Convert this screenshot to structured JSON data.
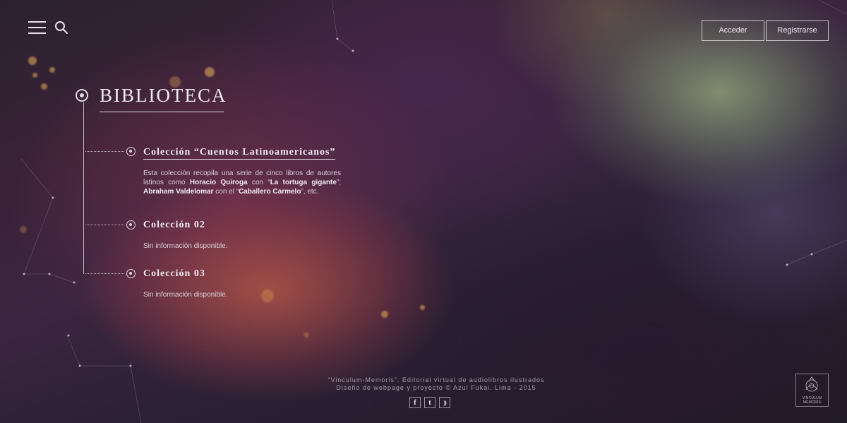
{
  "header": {
    "login_label": "Acceder",
    "register_label": "Registrarse"
  },
  "page": {
    "title": "BIBLIOTECA"
  },
  "collections": [
    {
      "title": "Colección “Cuentos Latinoamericanos”",
      "description_parts": [
        "Esta colección recopila una serie de cinco libros de autores latinos como ",
        "Horacio Quiroga",
        " con “",
        "La tortuga gigante",
        "”; ",
        "Abraham Valdelomar",
        " con el “",
        "Caballero Carmelo",
        "”, etc."
      ]
    },
    {
      "title": "Colección 02",
      "description": "Sin información disponible."
    },
    {
      "title": "Colección 03",
      "description": "Sin información disponible."
    }
  ],
  "footer": {
    "line1": "“Vinculum-Memoris”. Editorial virtual de audiolibros ilustrados",
    "line2": "Diseño de webpage y proyecto © Azul Fukai. Lima - 2015",
    "social": [
      {
        "icon": "facebook-icon",
        "glyph": "f"
      },
      {
        "icon": "twitter-icon",
        "glyph": "t"
      },
      {
        "icon": "rss-icon",
        "glyph": "))"
      }
    ],
    "logo_text": "VINCULUM MEMORIS"
  },
  "colors": {
    "text": "#e8dfe6",
    "accent_glow": "#f0b45a"
  }
}
